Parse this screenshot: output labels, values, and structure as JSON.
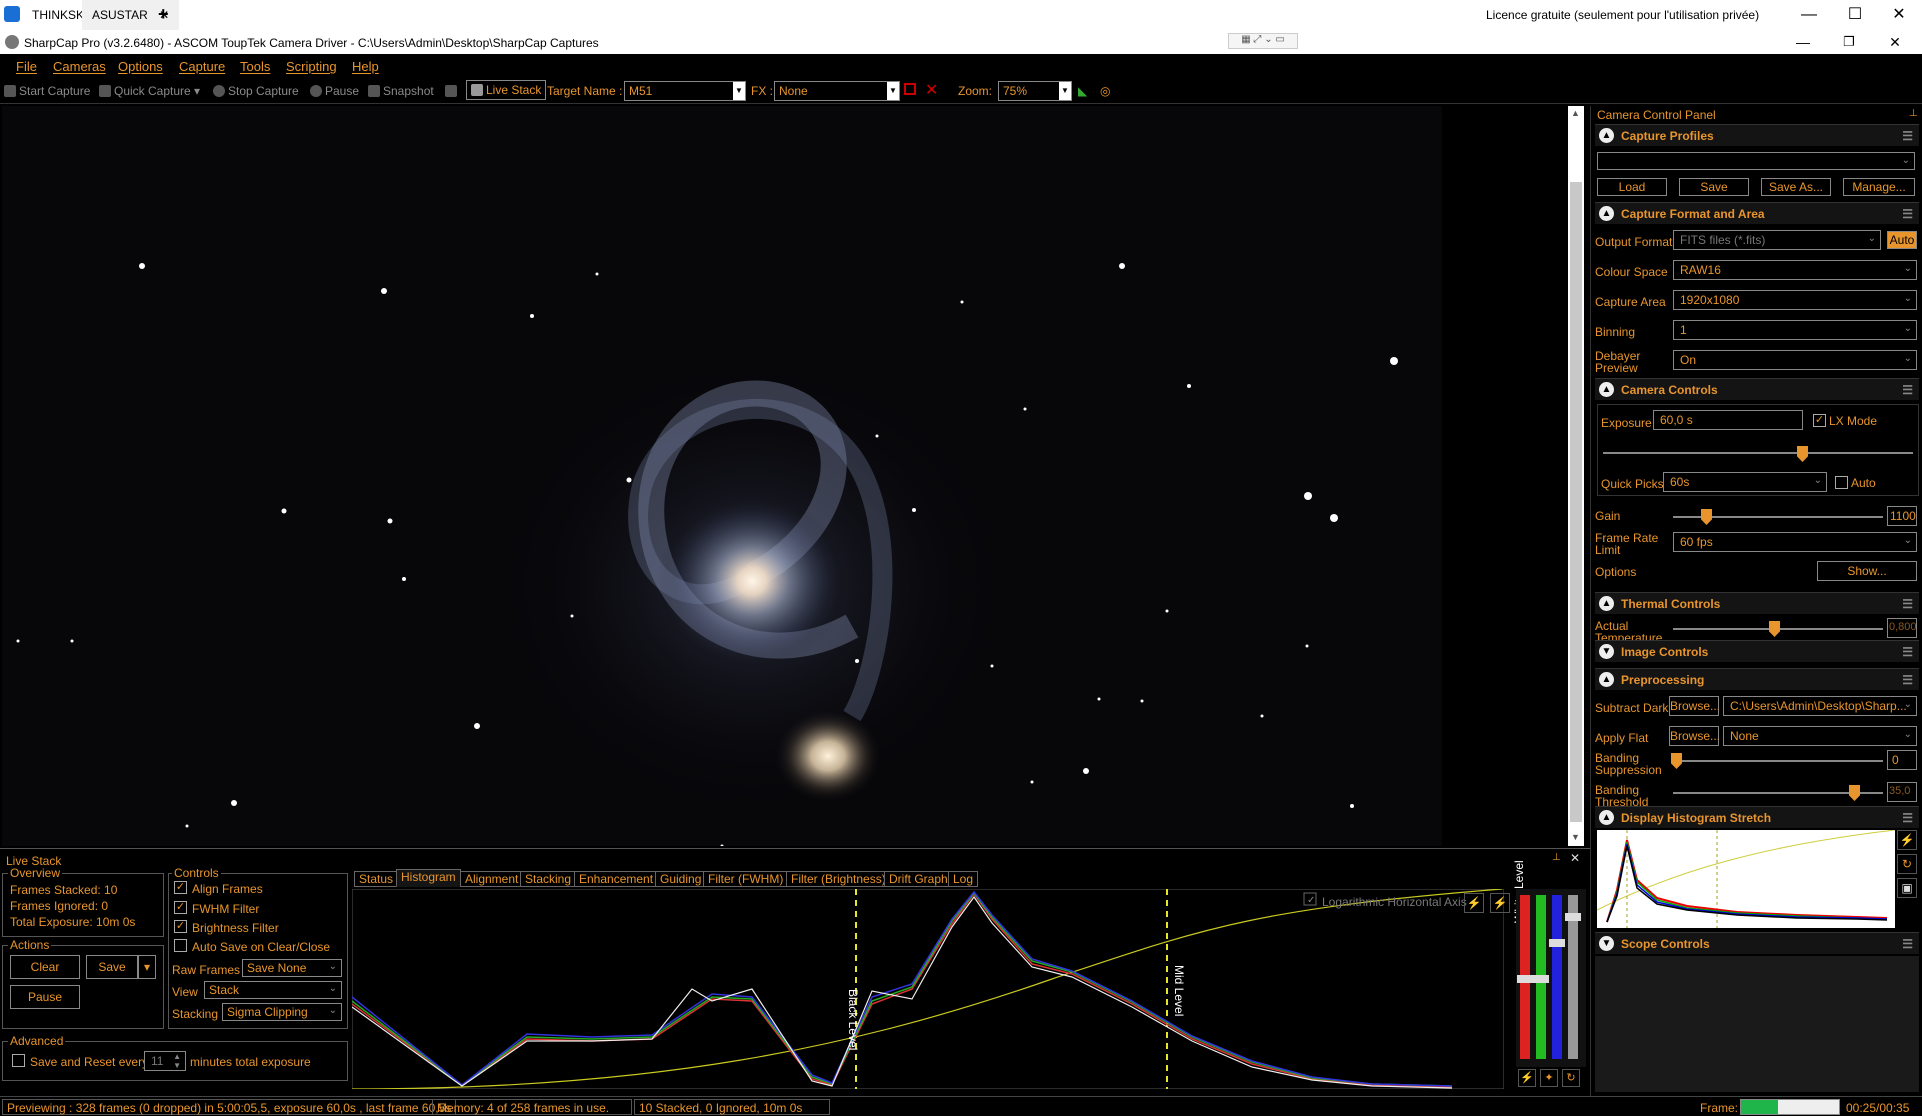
{
  "remote_tabs": [
    {
      "label": "THINKSKY"
    },
    {
      "label": "ASUSTAR"
    }
  ],
  "remote_notice": "Licence gratuite (seulement pour l'utilisation privée)",
  "window_title": "SharpCap Pro (v3.2.6480) - ASCOM ToupTek Camera Driver - C:\\Users\\Admin\\Desktop\\SharpCap Captures",
  "menu": [
    "File",
    "Cameras",
    "Options",
    "Capture",
    "Tools",
    "Scripting",
    "Help"
  ],
  "toolbar": {
    "start_capture": "Start Capture",
    "quick_capture": "Quick Capture",
    "stop_capture": "Stop Capture",
    "pause": "Pause",
    "snapshot": "Snapshot",
    "live_stack": "Live Stack",
    "target_label": "Target Name :",
    "target_value": "M51",
    "fx_label": "FX :",
    "fx_value": "None",
    "zoom_label": "Zoom:",
    "zoom_value": "75%"
  },
  "panel": {
    "title": "Camera Control Panel",
    "capture_profiles": {
      "title": "Capture Profiles",
      "load": "Load",
      "save": "Save",
      "save_as": "Save As...",
      "manage": "Manage..."
    },
    "capture_format": {
      "title": "Capture Format and Area",
      "output_format_label": "Output Format",
      "output_format": "FITS files (*.fits)",
      "auto": "Auto",
      "colour_space_label": "Colour Space",
      "colour_space": "RAW16",
      "capture_area_label": "Capture Area",
      "capture_area": "1920x1080",
      "binning_label": "Binning",
      "binning": "1",
      "debayer_label_1": "Debayer",
      "debayer_label_2": "Preview",
      "debayer": "On"
    },
    "camera_controls": {
      "title": "Camera Controls",
      "exposure_label": "Exposure",
      "exposure": "60,0 s",
      "lx_mode": "LX Mode",
      "quick_picks_label": "Quick Picks",
      "quick_picks": "60s",
      "auto": "Auto",
      "gain_label": "Gain",
      "gain": "1100",
      "frame_rate_label_1": "Frame Rate",
      "frame_rate_label_2": "Limit",
      "frame_rate": "60 fps",
      "options_label": "Options",
      "show": "Show..."
    },
    "thermal": {
      "title": "Thermal Controls",
      "actual_temp_label_1": "Actual",
      "actual_temp_label_2": "Temperature",
      "actual_temp": "0,800"
    },
    "image_controls": {
      "title": "Image Controls"
    },
    "preprocessing": {
      "title": "Preprocessing",
      "subtract_dark_label": "Subtract Dark",
      "browse": "Browse...",
      "dark_path": "C:\\Users\\Admin\\Desktop\\Sharp...",
      "apply_flat_label": "Apply Flat",
      "flat": "None",
      "banding_supp_label_1": "Banding",
      "banding_supp_label_2": "Suppression",
      "banding_supp": "0",
      "banding_thr_label_1": "Banding",
      "banding_thr_label_2": "Threshold",
      "banding_thr": "35,0"
    },
    "histogram_stretch": {
      "title": "Display Histogram Stretch"
    },
    "scope_controls": {
      "title": "Scope Controls"
    }
  },
  "livestack": {
    "title": "Live Stack",
    "overview": {
      "title": "Overview",
      "frames_stacked": "Frames Stacked:  10",
      "frames_ignored": "Frames Ignored:  0",
      "total_exposure": "Total Exposure:   10m 0s"
    },
    "actions": {
      "title": "Actions",
      "clear": "Clear",
      "save": "Save",
      "pause": "Pause"
    },
    "advanced": {
      "title": "Advanced",
      "save_reset": "Save and Reset every",
      "minutes": "11",
      "minutes_label": "minutes total exposure"
    },
    "controls": {
      "title": "Controls",
      "align": "Align Frames",
      "fwhm": "FWHM Filter",
      "brightness": "Brightness Filter",
      "autosave": "Auto Save on Clear/Close",
      "raw_frames_label": "Raw Frames",
      "raw_frames": "Save None",
      "view_label": "View",
      "view": "Stack",
      "stacking_label": "Stacking",
      "stacking": "Sigma Clipping"
    },
    "tabs": [
      "Status",
      "Histogram",
      "Alignment",
      "Stacking",
      "Enhancement",
      "Guiding",
      "Filter (FWHM)",
      "Filter (Brightness)",
      "Drift Graph",
      "Log"
    ],
    "log_axis": "Logarithmic Horizontal Axis",
    "black_level": "Black Level",
    "mid_level": "Mid Level",
    "white_level": "White Level"
  },
  "status": {
    "previewing": "Previewing : 328 frames (0 dropped) in 5:00:05,5, exposure 60,0s , last frame 60,5s",
    "memory": "Memory: 4 of 258 frames in use.",
    "stack": "10 Stacked, 0 Ignored, 10m 0s",
    "frame_label": "Frame:",
    "frame_progress": 0.38,
    "frame_time": "00:25/00:35"
  },
  "colors": {
    "accent": "#e8952e",
    "background": "#000000"
  }
}
